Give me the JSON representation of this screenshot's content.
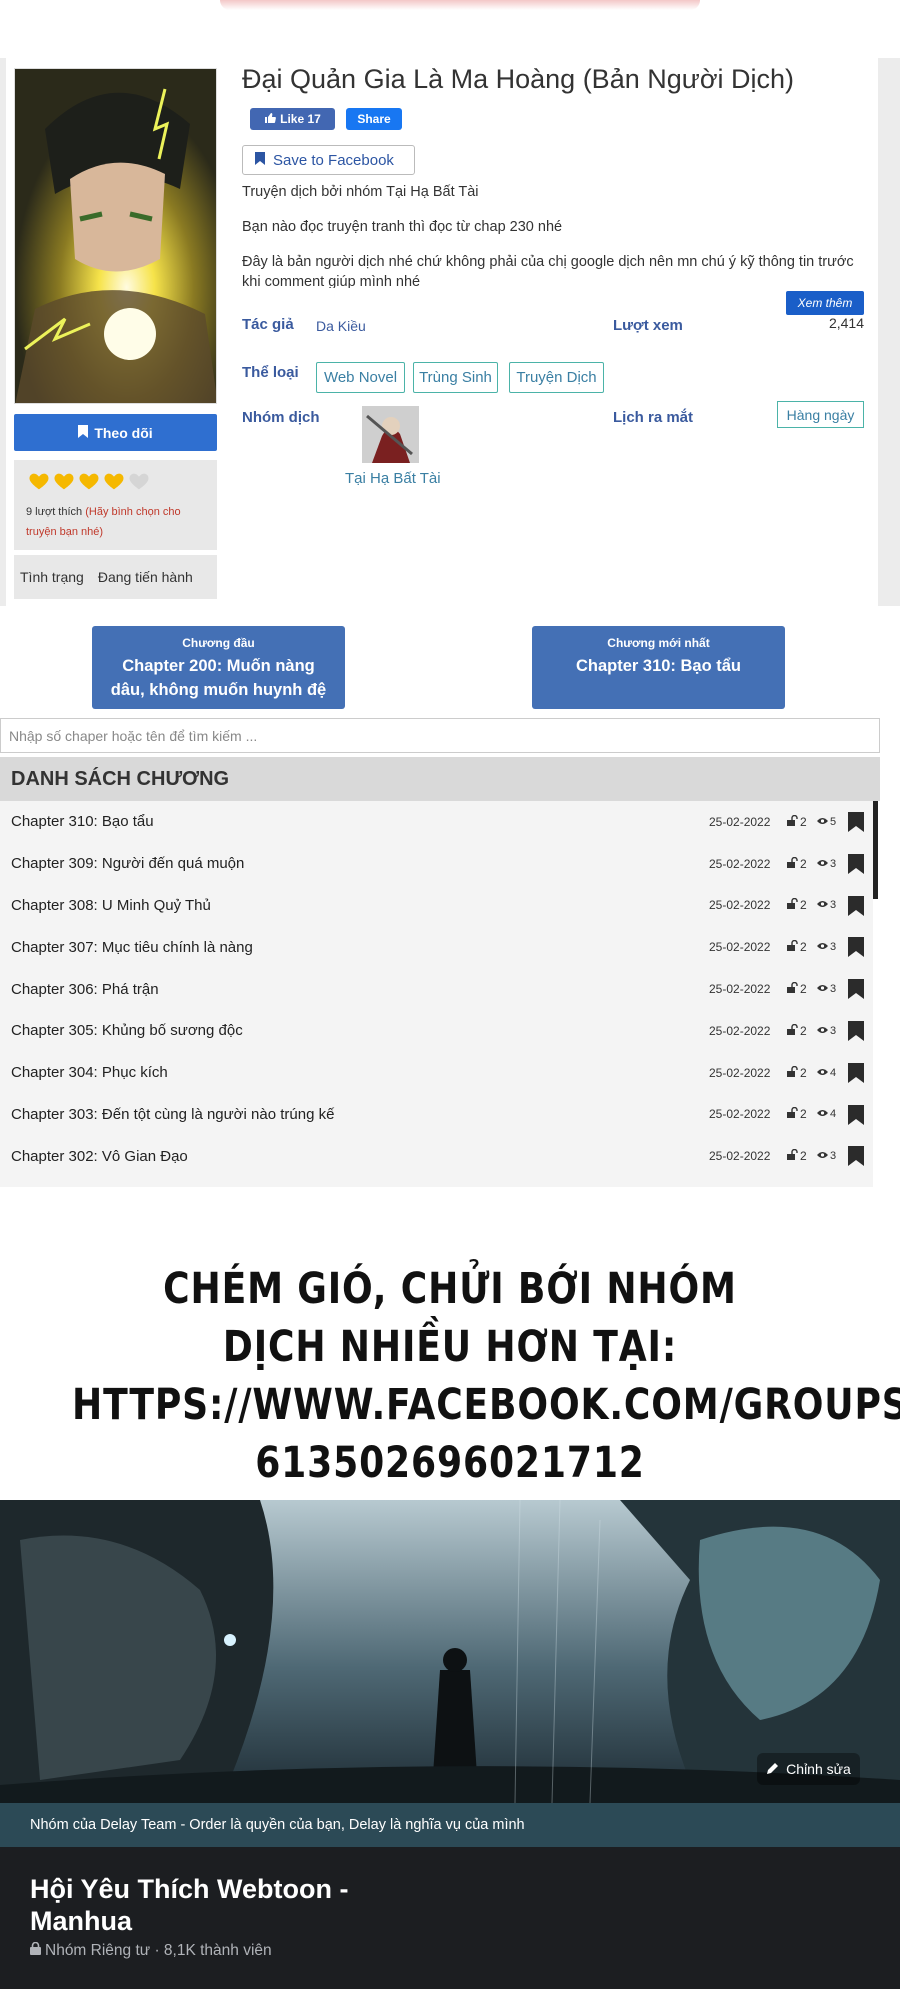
{
  "manga": {
    "title": "Đại Quản Gia Là Ma Hoàng (Bản Người Dịch)",
    "fb_like_label": "Like 17",
    "fb_share_label": "Share",
    "save_label": "Save to Facebook",
    "description": [
      "Truyện dịch bởi nhóm Tại Hạ Bất Tài",
      "Bạn nào đọc truyện tranh thì đọc từ chap 230 nhé",
      "Đây là bản người dịch nhé chứ không phải của chị google dịch nên mn chú ý kỹ thông tin trước khi comment giúp mình nhé"
    ],
    "see_more_label": "Xem thêm",
    "author_label": "Tác giả",
    "author": "Da Kiều",
    "views_label": "Lượt xem",
    "views": "2,414",
    "genre_label": "Thể loại",
    "genres": [
      "Web Novel",
      "Trùng Sinh",
      "Truyện Dịch"
    ],
    "group_label": "Nhóm dịch",
    "group_name": "Tại Hạ Bất Tài",
    "release_label": "Lịch ra mắt",
    "release": "Hàng ngày",
    "follow_label": "Theo dõi",
    "rating_stars": 4,
    "rating_max": 5,
    "likes_text": "9 lượt thích",
    "rating_hint": "(Hãy bình chọn cho truyện bạn nhé)",
    "status_label": "Tình trạng",
    "status": "Đang tiến hành",
    "colors": {
      "primary_blue": "#2f6fd0",
      "chapter_btn": "#4470b5",
      "star": "#f5b800"
    }
  },
  "first_chapter": {
    "label": "Chương đầu",
    "title": "Chapter 200: Muốn nàng dâu, không muốn huynh đệ"
  },
  "latest_chapter": {
    "label": "Chương mới nhất",
    "title": "Chapter 310: Bạo tẩu"
  },
  "search": {
    "placeholder": "Nhập số chaper hoặc tên để tìm kiếm ..."
  },
  "chapter_list": {
    "header": "DANH SÁCH CHƯƠNG",
    "rows": [
      {
        "name": "Chapter 310: Bạo tẩu",
        "date": "25-02-2022",
        "locks": "2",
        "views": "5"
      },
      {
        "name": "Chapter 309: Người đến quá muộn",
        "date": "25-02-2022",
        "locks": "2",
        "views": "3"
      },
      {
        "name": "Chapter 308: U Minh Quỷ Thủ",
        "date": "25-02-2022",
        "locks": "2",
        "views": "3"
      },
      {
        "name": "Chapter 307: Mục tiêu chính là nàng",
        "date": "25-02-2022",
        "locks": "2",
        "views": "3"
      },
      {
        "name": "Chapter 306: Phá trận",
        "date": "25-02-2022",
        "locks": "2",
        "views": "3"
      },
      {
        "name": "Chapter 305: Khủng bố sương độc",
        "date": "25-02-2022",
        "locks": "2",
        "views": "3"
      },
      {
        "name": "Chapter 304: Phục kích",
        "date": "25-02-2022",
        "locks": "2",
        "views": "4"
      },
      {
        "name": "Chapter 303: Đến tột cùng là người nào trúng kế",
        "date": "25-02-2022",
        "locks": "2",
        "views": "4"
      },
      {
        "name": "Chapter 302: Vô Gian Đạo",
        "date": "25-02-2022",
        "locks": "2",
        "views": "3"
      }
    ]
  },
  "banner": {
    "lines": [
      "CHÉM GIÓ, CHỬI BỚI NHÓM",
      "DỊCH NHIỀU HƠN TẠI:",
      "HTTPS://WWW.FACEBOOK.COM/GROUPS/",
      "613502696021712"
    ]
  },
  "fb_group": {
    "edit_label": "Chỉnh sửa",
    "caption": "Nhóm của Delay Team - Order là quyền của bạn, Delay là nghĩa vụ của mình",
    "name_line1": "Hội Yêu Thích Webtoon -",
    "name_line2": "Manhua",
    "meta": "Nhóm Riêng tư · 8,1K thành viên"
  }
}
